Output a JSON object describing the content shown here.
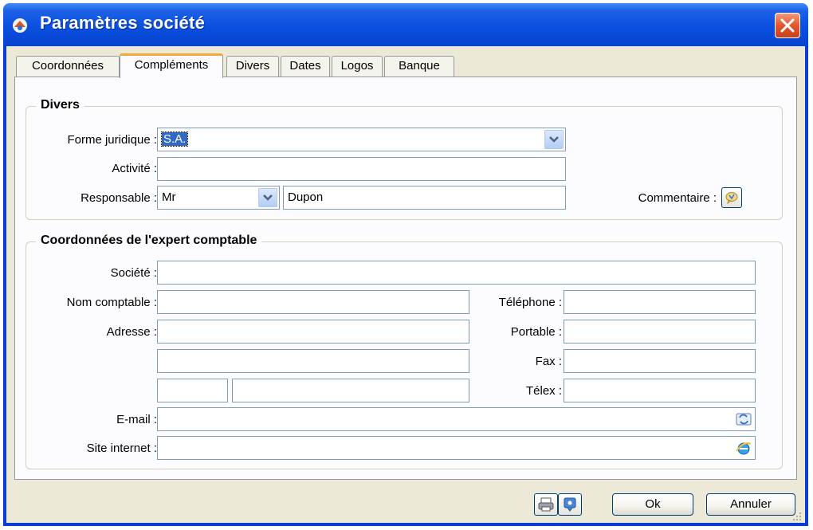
{
  "window": {
    "title": "Paramètres société"
  },
  "tabs": [
    {
      "label": "Coordonnées",
      "active": false
    },
    {
      "label": "Compléments",
      "active": true
    },
    {
      "label": "Divers",
      "active": false
    },
    {
      "label": "Dates",
      "active": false
    },
    {
      "label": "Logos",
      "active": false
    },
    {
      "label": "Banque",
      "active": false
    }
  ],
  "divers": {
    "legend": "Divers",
    "forme_juridique": {
      "label": "Forme juridique :",
      "value": "S.A."
    },
    "activite": {
      "label": "Activité :",
      "value": ""
    },
    "responsable": {
      "label": "Responsable :",
      "civilite": "Mr",
      "nom": "Dupon"
    },
    "commentaire": {
      "label": "Commentaire :"
    }
  },
  "expert": {
    "legend": "Coordonnées de l'expert comptable",
    "societe": {
      "label": "Société :",
      "value": ""
    },
    "nom_comptable": {
      "label": "Nom comptable :",
      "value": ""
    },
    "adresse": {
      "label": "Adresse :",
      "line1": "",
      "line2": "",
      "code_postal": "",
      "ville": ""
    },
    "telephone": {
      "label": "Téléphone :",
      "value": ""
    },
    "portable": {
      "label": "Portable :",
      "value": ""
    },
    "fax": {
      "label": "Fax :",
      "value": ""
    },
    "telex": {
      "label": "Télex :",
      "value": ""
    },
    "email": {
      "label": "E-mail :",
      "value": ""
    },
    "site": {
      "label": "Site internet :",
      "value": ""
    }
  },
  "footer": {
    "ok_label": "Ok",
    "cancel_label": "Annuler"
  },
  "icons": {
    "app": "app-icon",
    "close": "close-icon",
    "comment": "comment-icon",
    "email": "mail-send-icon",
    "web": "internet-explorer-icon",
    "print": "printer-icon",
    "help": "help-icon"
  },
  "colors": {
    "titlebar": "#0a4fe0",
    "active_tab_accent": "#f5a93b",
    "selection": "#3169c6",
    "face": "#ece9d8"
  }
}
